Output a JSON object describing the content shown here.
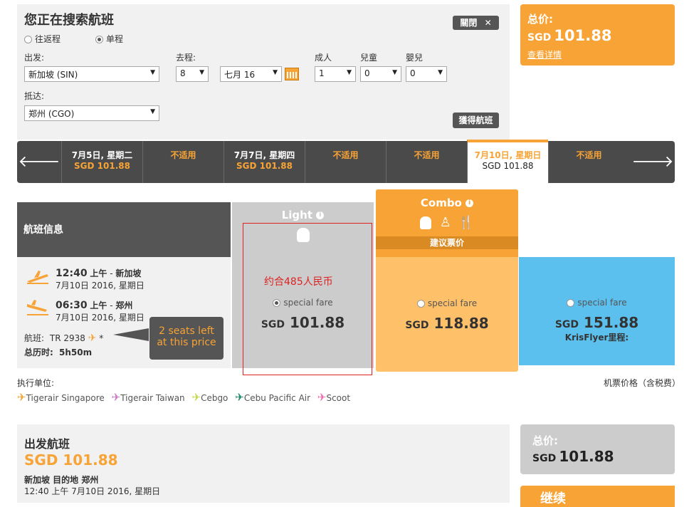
{
  "search": {
    "title": "您正在搜索航班",
    "trip_round": "往返程",
    "trip_oneway": "单程",
    "from_label": "出发:",
    "from_value": "新加坡 (SIN)",
    "depart_label": "去程:",
    "depart_day": "8",
    "depart_month": "七月 16",
    "adult_label": "成人",
    "child_label": "兒童",
    "infant_label": "嬰兒",
    "adult_value": "1",
    "child_value": "0",
    "infant_value": "0",
    "to_label": "抵达:",
    "to_value": "郑州 (CGO)",
    "close_label": "關閉",
    "submit_label": "獲得航班"
  },
  "total": {
    "label": "总价:",
    "currency": "SGD",
    "amount": "101.88",
    "detail_link": "查看详情"
  },
  "dates": [
    {
      "date": "7月5日, 星期二",
      "price": "SGD 101.88"
    },
    {
      "date": "",
      "price": "不适用"
    },
    {
      "date": "7月7日, 星期四",
      "price": "SGD 101.88"
    },
    {
      "date": "",
      "price": "不适用"
    },
    {
      "date": "",
      "price": "不适用"
    },
    {
      "date": "7月10日, 星期日",
      "price": "SGD 101.88"
    },
    {
      "date": "",
      "price": "不适用"
    }
  ],
  "fare_table": {
    "info_header": "航班信息",
    "light_title": "Light",
    "combo_title": "Combo",
    "combo_tag": "建议票价",
    "annotation": "约合485人民币",
    "light": {
      "radio": "special fare",
      "currency": "SGD",
      "amount": "101.88"
    },
    "combo": {
      "radio": "special fare",
      "currency": "SGD",
      "amount": "118.88"
    },
    "kris": {
      "radio": "special fare",
      "currency": "SGD",
      "amount": "151.88",
      "note": "KrisFlyer里程:"
    }
  },
  "flight": {
    "dep_time": "12:40",
    "dep_ampm": "上午",
    "dep_city": "新加坡",
    "dep_date": "7月10日 2016, 星期日",
    "arr_time": "06:30",
    "arr_ampm": "上午",
    "arr_city": "郑州",
    "arr_date": "7月10日 2016, 星期日",
    "flight_label": "航班:",
    "flight_no": "TR 2938",
    "flight_star": "*",
    "duration_label": "总历时:",
    "duration": "5h50m",
    "seats_note": "2 seats left at this price"
  },
  "operators": {
    "label": "执行单位:",
    "items": [
      "Tigerair Singapore",
      "Tigerair Taiwan",
      "Cebgo",
      "Cebu Pacific Air",
      "Scoot"
    ],
    "colors": [
      "#f7a336",
      "#c879c9",
      "#c5d84a",
      "#1a8a6a",
      "#f06ab0"
    ],
    "price_note": "机票价格（含税费）"
  },
  "departure_summary": {
    "title": "出发航班",
    "price": "SGD 101.88",
    "route": "新加坡 目的地 郑州",
    "time": "12:40 上午 7月10日 2016, 星期日"
  },
  "total2": {
    "label": "总价:",
    "currency": "SGD",
    "amount": "101.88"
  },
  "continue_label": "继续",
  "colors": {
    "orange": "#f7a336",
    "dark": "#4a4a4a",
    "blue": "#5bc0ee"
  }
}
